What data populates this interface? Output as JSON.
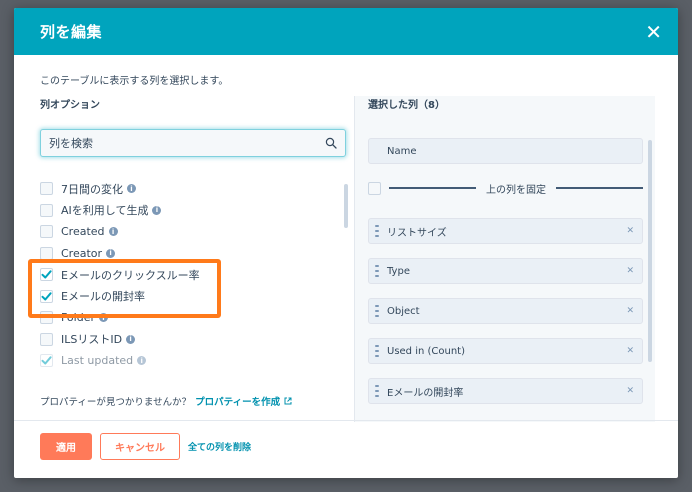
{
  "modal": {
    "title": "列を編集",
    "close_label": "✕",
    "description": "このテーブルに表示する列を選択します。"
  },
  "left": {
    "section_label": "列オプション",
    "search": {
      "value": "列を検索",
      "placeholder": "列を検索"
    },
    "options": [
      {
        "label": "7日間の変化",
        "checked": false,
        "info": true
      },
      {
        "label": "AIを利用して生成",
        "checked": false,
        "info": true
      },
      {
        "label": "Created",
        "checked": false,
        "info": true
      },
      {
        "label": "Creator",
        "checked": false,
        "info": true
      },
      {
        "label": "Eメールのクリックスルー率",
        "checked": true,
        "info": false
      },
      {
        "label": "Eメールの開封率",
        "checked": true,
        "info": false
      },
      {
        "label": "Folder",
        "checked": false,
        "info": true
      },
      {
        "label": "ILSリストID",
        "checked": false,
        "info": true
      },
      {
        "label": "Last updated",
        "checked": true,
        "info": true
      }
    ],
    "missing_prefix": "プロパティーが見つかりませんか？",
    "create_link": "プロパティーを作成"
  },
  "right": {
    "section_label": "選択した列（8）",
    "name_item": "Name",
    "freeze_label": "上の列を固定",
    "items": [
      "リストサイズ",
      "Type",
      "Object",
      "Used in (Count)",
      "Eメールの開封率"
    ]
  },
  "footer": {
    "apply": "適用",
    "cancel": "キャンセル",
    "clear_all": "全ての列を削除"
  },
  "colors": {
    "header": "#00a4bd",
    "accent": "#ff7a59",
    "highlight": "#ff7a1a",
    "link": "#0091ae"
  }
}
